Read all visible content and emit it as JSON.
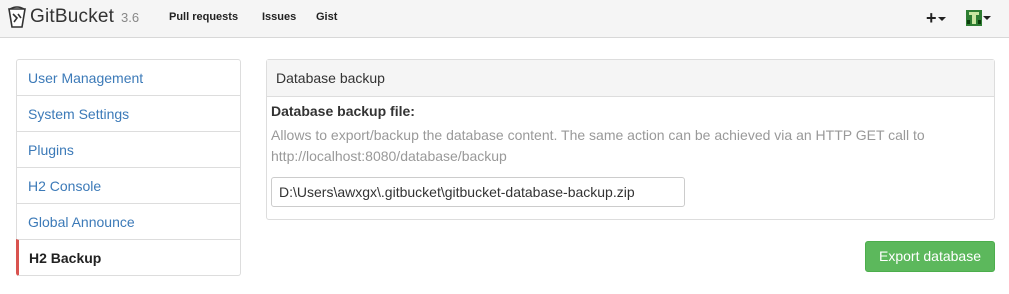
{
  "header": {
    "brand": "GitBucket",
    "version": "3.6",
    "nav": [
      {
        "label": "Pull requests"
      },
      {
        "label": "Issues"
      },
      {
        "label": "Gist"
      }
    ],
    "plus_label": "+"
  },
  "sidebar": {
    "items": [
      {
        "label": "User Management"
      },
      {
        "label": "System Settings"
      },
      {
        "label": "Plugins"
      },
      {
        "label": "H2 Console"
      },
      {
        "label": "Global Announce"
      },
      {
        "label": "H2 Backup"
      }
    ],
    "active_index": 5
  },
  "panel": {
    "heading": "Database backup",
    "field_label": "Database backup file:",
    "help_line1": "Allows to export/backup the database content. The same action can be achieved via an HTTP GET call to",
    "help_line2": "http://localhost:8080/database/backup",
    "path_value": "D:\\Users\\awxgx\\.gitbucket\\gitbucket-database-backup.zip"
  },
  "export_button": "Export database",
  "colors": {
    "link": "#3c7ab8",
    "active_marker": "#d9534f",
    "success": "#5cb85c"
  }
}
